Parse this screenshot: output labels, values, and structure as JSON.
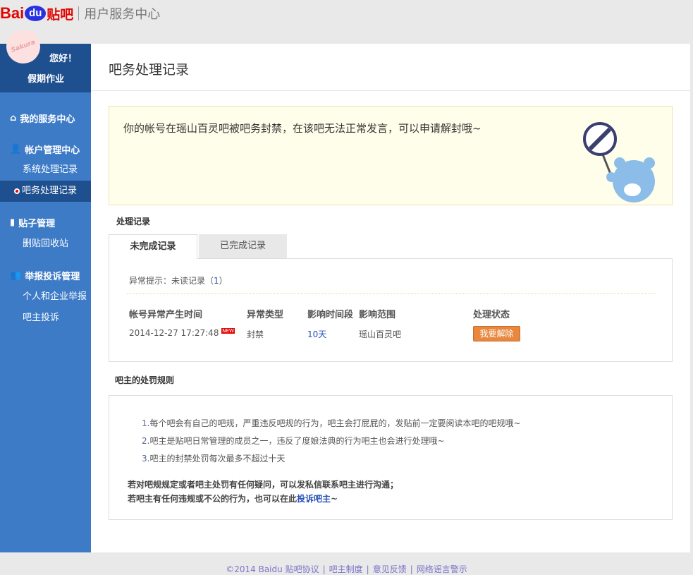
{
  "header": {
    "logo_bai": "Bai",
    "logo_du": "du",
    "logo_tieba": "贴吧",
    "subtitle": "用户服务中心"
  },
  "user": {
    "avatar_text": "Sakura",
    "greeting": "您好！",
    "name": "假期作业"
  },
  "sidebar": {
    "sections": [
      {
        "label": "我的服务中心",
        "icon": "home-icon"
      },
      {
        "label": "帐户管理中心",
        "icon": "user-icon",
        "items": [
          "系统处理记录",
          "吧务处理记录"
        ]
      },
      {
        "label": "贴子管理",
        "icon": "document-icon",
        "items": [
          "删贴回收站"
        ]
      },
      {
        "label": "举报投诉管理",
        "icon": "users-icon",
        "items": [
          "个人和企业举报",
          "吧主投诉"
        ]
      }
    ],
    "active": "吧务处理记录"
  },
  "main": {
    "title": "吧务处理记录",
    "notice": "你的帐号在瑶山百灵吧被吧务封禁，在该吧无法正常发言，可以申请解封哦~",
    "records_heading": "处理记录",
    "tabs": [
      "未完成记录",
      "已完成记录"
    ],
    "alert_label": "异常提示：未读记录（",
    "alert_count": "1",
    "alert_close": "）",
    "columns": [
      "帐号异常产生时间",
      "异常类型",
      "影响时间段",
      "影响范围",
      "处理状态"
    ],
    "rows": [
      {
        "time": "2014-12-27 17:27:48",
        "badge": "NEW",
        "type": "封禁",
        "duration": "10天",
        "scope": "瑶山百灵吧",
        "action": "我要解除"
      }
    ],
    "rules_heading": "吧主的处罚规则",
    "rules": [
      "1.",
      "每个吧会有自己的吧规，严重违反吧规的行为，吧主会打屁屁的，发贴前一定要阅读本吧的吧规哦~",
      "2.",
      "吧主是贴吧日常管理的成员之一，违反了度娘法典的行为吧主也会进行处理哦~",
      "3.",
      "吧主的封禁处罚每次最多不超过十天"
    ],
    "note1": "若对吧规规定或者吧主处罚有任何疑问，可以发私信联系吧主进行沟通；",
    "note2": "若吧主有任何违规或不公的行为，也可以在此",
    "note2_link": "投诉吧主",
    "note2_end": "~"
  },
  "footer": {
    "copyright": "©2014 Baidu",
    "links": [
      "贴吧协议",
      "吧主制度",
      "意见反馈",
      "网络谣言警示"
    ]
  }
}
